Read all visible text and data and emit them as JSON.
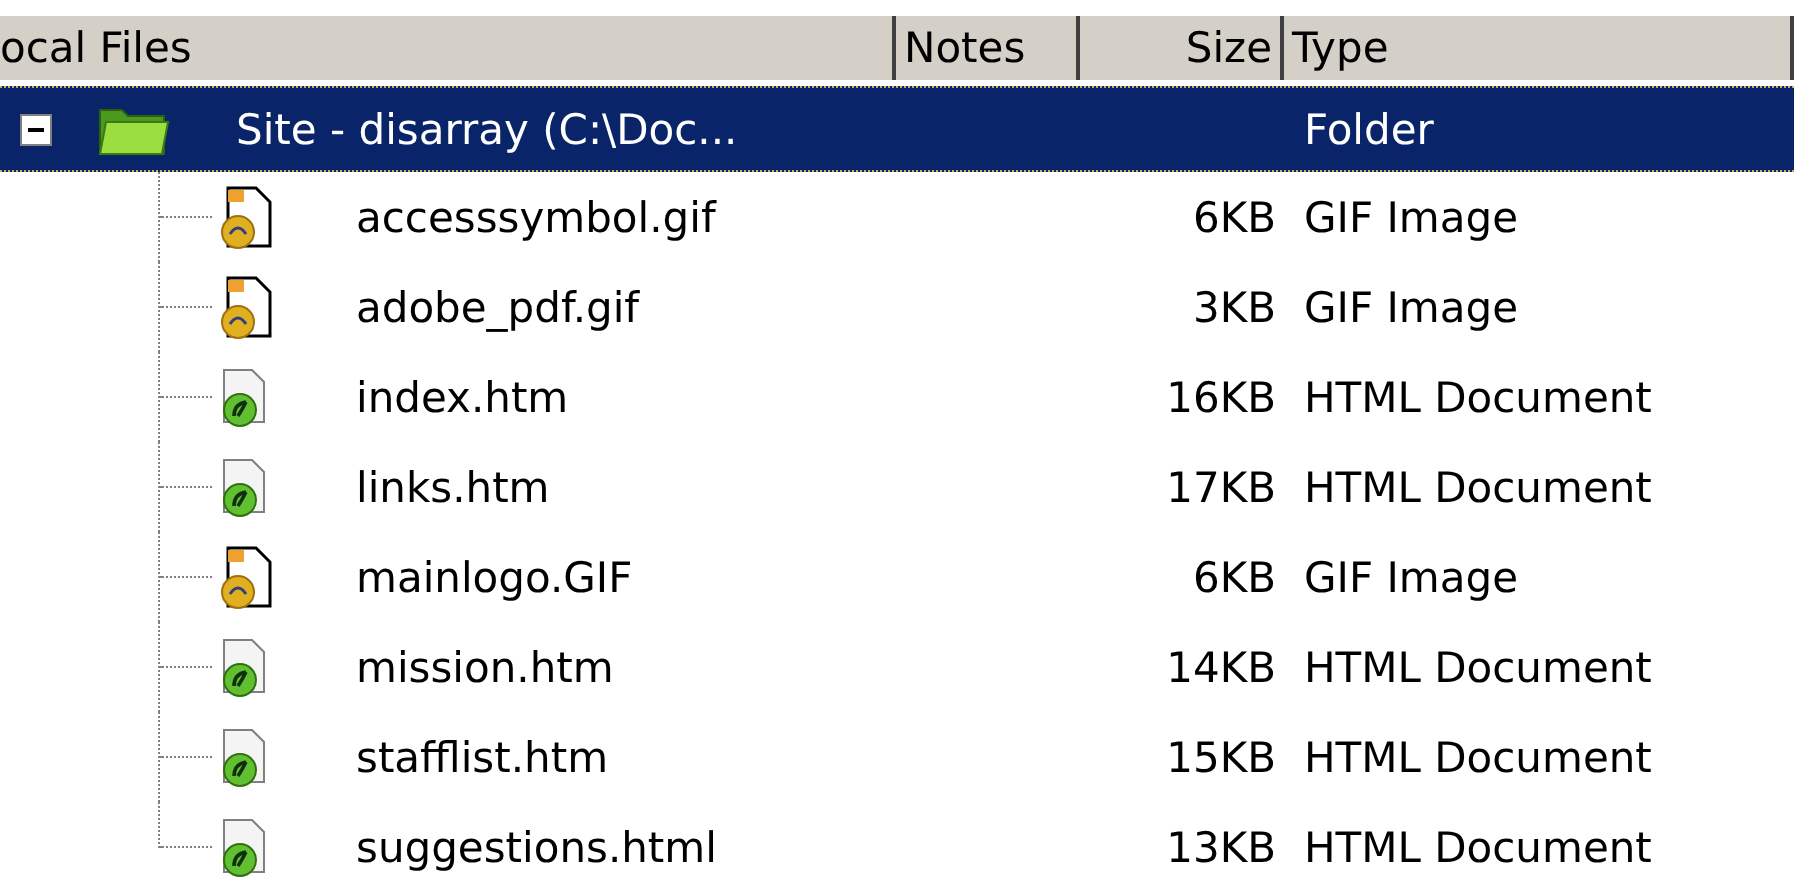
{
  "columns": [
    "ocal Files",
    "Notes",
    "Size",
    "Type"
  ],
  "root": {
    "name": "Site - disarray (C:\\Doc...",
    "type": "Folder",
    "expanded": true,
    "selected": true,
    "children": [
      {
        "name": "accesssymbol.gif",
        "size": "6KB",
        "type": "GIF Image",
        "kind": "image",
        "selected": false
      },
      {
        "name": "adobe_pdf.gif",
        "size": "3KB",
        "type": "GIF Image",
        "kind": "image",
        "selected": false
      },
      {
        "name": "index.htm",
        "size": "16KB",
        "type": "HTML Document",
        "kind": "html",
        "selected": false
      },
      {
        "name": "links.htm",
        "size": "17KB",
        "type": "HTML Document",
        "kind": "html",
        "selected": false
      },
      {
        "name": "mainlogo.GIF",
        "size": "6KB",
        "type": "GIF Image",
        "kind": "image",
        "selected": false
      },
      {
        "name": "mission.htm",
        "size": "14KB",
        "type": "HTML Document",
        "kind": "html",
        "selected": false
      },
      {
        "name": "stafflist.htm",
        "size": "15KB",
        "type": "HTML Document",
        "kind": "html",
        "selected": false
      },
      {
        "name": "suggestions.html",
        "size": "13KB",
        "type": "HTML Document",
        "kind": "html",
        "selected": false
      }
    ]
  }
}
